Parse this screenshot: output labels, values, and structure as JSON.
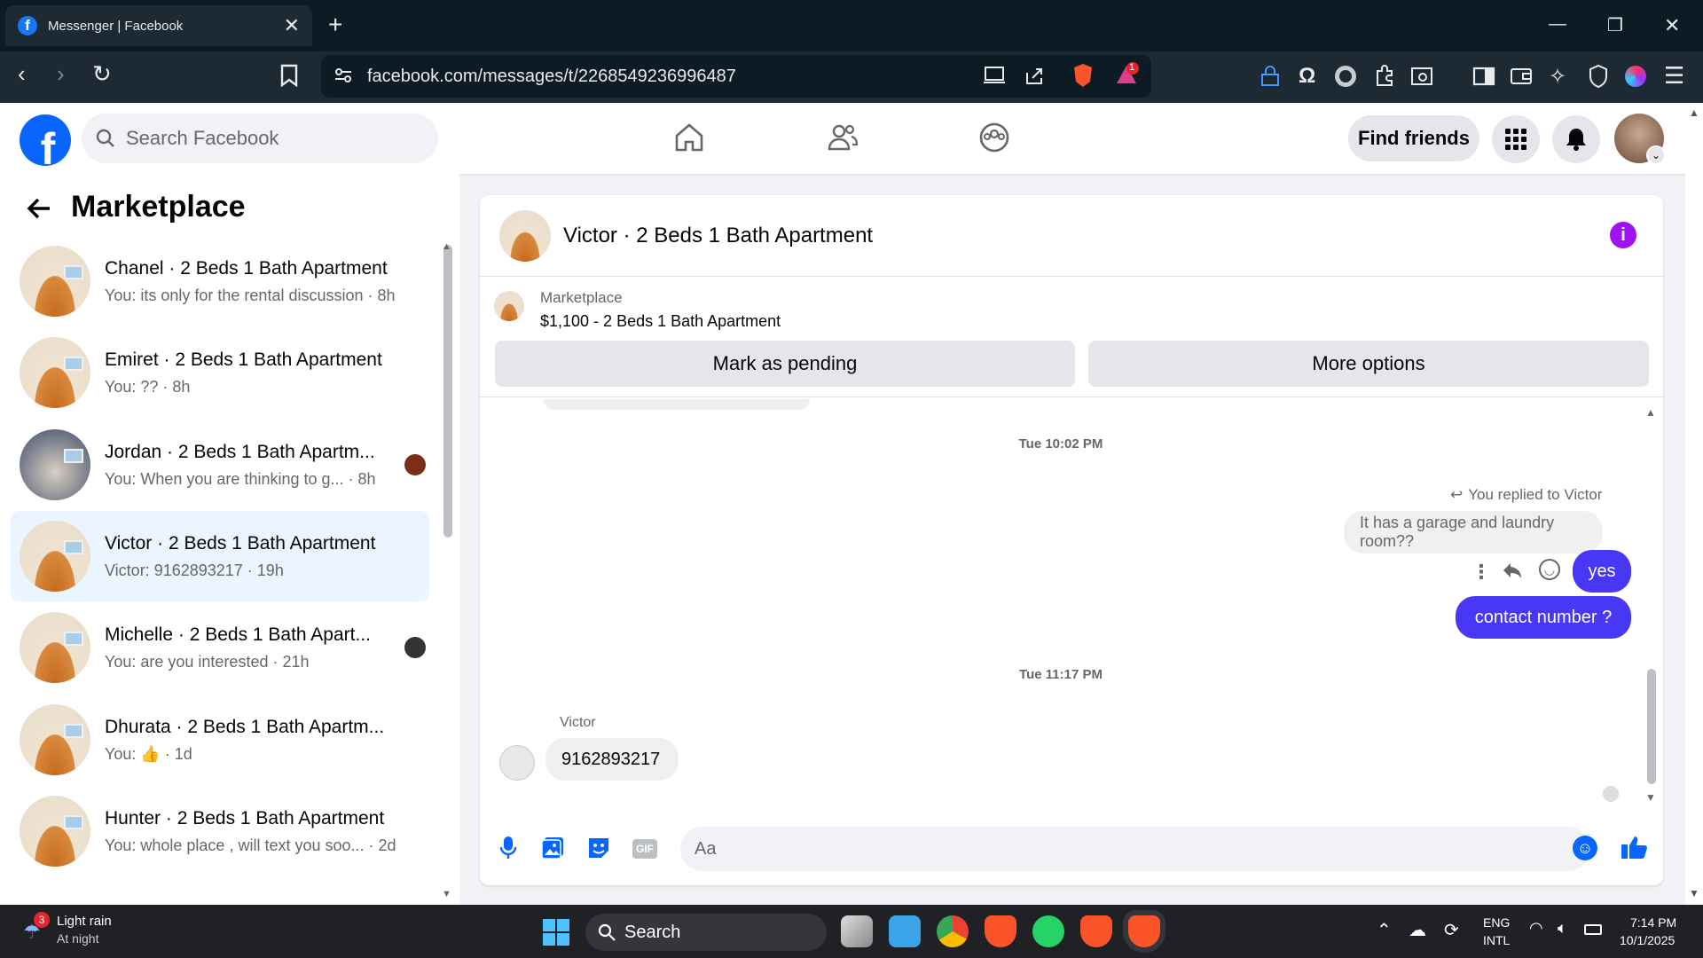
{
  "browser": {
    "tab_title": "Messenger | Facebook",
    "url": "facebook.com/messages/t/2268549236996487",
    "badge_count": "1"
  },
  "fb": {
    "search_placeholder": "Search Facebook",
    "find_friends": "Find friends"
  },
  "left": {
    "title": "Marketplace",
    "conversations": [
      {
        "name": "Chanel · 2 Beds 1 Bath Apartment",
        "preview": "You: its only for the rental discussion · 8h"
      },
      {
        "name": "Emiret · 2 Beds 1 Bath Apartment",
        "preview": "You: ?? · 8h"
      },
      {
        "name": "Jordan · 2 Beds 1 Bath Apartm...",
        "preview": "You: When you are thinking to g... · 8h"
      },
      {
        "name": "Victor · 2 Beds 1 Bath Apartment",
        "preview": "Victor: 9162893217 · 19h"
      },
      {
        "name": "Michelle · 2 Beds 1 Bath Apart...",
        "preview": "You: are you interested · 21h"
      },
      {
        "name": "Dhurata · 2 Beds 1 Bath Apartm...",
        "preview": "You: 👍 · 1d"
      },
      {
        "name": "Hunter · 2 Beds 1 Bath Apartment",
        "preview": "You: whole place , will text you soo... · 2d"
      }
    ]
  },
  "chat": {
    "title": "Victor · 2 Beds 1 Bath Apartment",
    "marketplace_label": "Marketplace",
    "listing": "$1,100 - 2 Beds 1 Bath Apartment",
    "mark_pending": "Mark as pending",
    "more_options": "More options",
    "ts1": "Tue 10:02 PM",
    "replied_to": "You replied to Victor",
    "quoted": "It has a garage and laundry room??",
    "msg_yes": "yes",
    "msg_contact": "contact number ?",
    "ts2": "Tue 11:17 PM",
    "sender": "Victor",
    "msg_number": "9162893217",
    "composer_placeholder": "Aa"
  },
  "taskbar": {
    "weather_title": "Light rain",
    "weather_sub": "At night",
    "weather_badge": "3",
    "search": "Search",
    "lang1": "ENG",
    "lang2": "INTL",
    "time": "7:14 PM",
    "date": "10/1/2025"
  }
}
